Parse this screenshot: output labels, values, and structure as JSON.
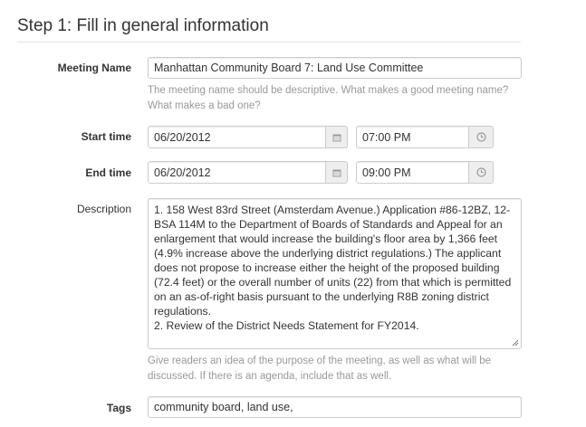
{
  "step_heading": "Step 1: Fill in general information",
  "meeting_name": {
    "label": "Meeting Name",
    "value": "Manhattan Community Board 7: Land Use Committee",
    "help_line1": "The meeting name should be descriptive. What makes a good meeting name?",
    "help_line2": "What makes a bad one?"
  },
  "start_time": {
    "label": "Start time",
    "date": "06/20/2012",
    "time": "07:00 PM"
  },
  "end_time": {
    "label": "End time",
    "date": "06/20/2012",
    "time": "09:00 PM"
  },
  "description": {
    "label": "Description",
    "lines": [
      "1.  158 West 83rd Street (Amsterdam Avenue.)  Application #86-12BZ, 12-",
      "BSA 114M to the Department of Boards of Standards and Appeal for an",
      "enlargement that would increase the building's floor area by 1,366 feet",
      "(4.9% increase above the underlying district regulations.) The applicant",
      "does not propose to increase either the height of the proposed building",
      "(72.4 feet) or the overall number of units (22) from that which is permitted",
      "on an as-of-right basis pursuant to the underlying R8B zoning district",
      "regulations.",
      "2.  Review of the District Needs Statement for FY2014."
    ],
    "help_line1": "Give readers an idea of the purpose of the meeting, as well as what will be",
    "help_line2": "discussed. If there is an agenda, include that as well."
  },
  "tags": {
    "label": "Tags",
    "value": "community board, land use,"
  },
  "icons": {
    "date": "calendar-icon",
    "time": "clock-icon"
  }
}
